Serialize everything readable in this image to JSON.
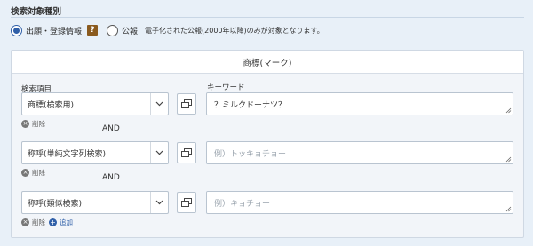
{
  "section": {
    "title": "検索対象種別"
  },
  "target": {
    "options": [
      {
        "label": "出願・登録情報",
        "checked": true
      },
      {
        "label": "公報",
        "checked": false
      }
    ],
    "help_icon": "?",
    "note": "電子化された公報(2000年以降)のみが対象となります。"
  },
  "card": {
    "title": "商標(マーク)",
    "field_label": "検索項目",
    "keyword_label": "キーワード",
    "rows": [
      {
        "item": "商標(検索用)",
        "keyword": "？ミルクドーナツ？",
        "placeholder": "",
        "delete_label": "削除"
      },
      {
        "connector": "AND"
      },
      {
        "item": "称呼(単純文字列検索)",
        "keyword": "",
        "placeholder": "例）トッキョチョー",
        "delete_label": "削除"
      },
      {
        "connector": "AND"
      },
      {
        "item": "称呼(類似検索)",
        "keyword": "",
        "placeholder": "例）キョチョー",
        "delete_label": "削除",
        "add_label": "追加"
      }
    ]
  },
  "icons": {
    "dropdown": "chevron-down-icon",
    "copy": "copy-icon",
    "delete": "close-circle-icon",
    "add": "plus-circle-icon"
  },
  "colors": {
    "accent": "#2f5fa8",
    "help": "#8a5a1e",
    "background": "#e8f0f8"
  }
}
